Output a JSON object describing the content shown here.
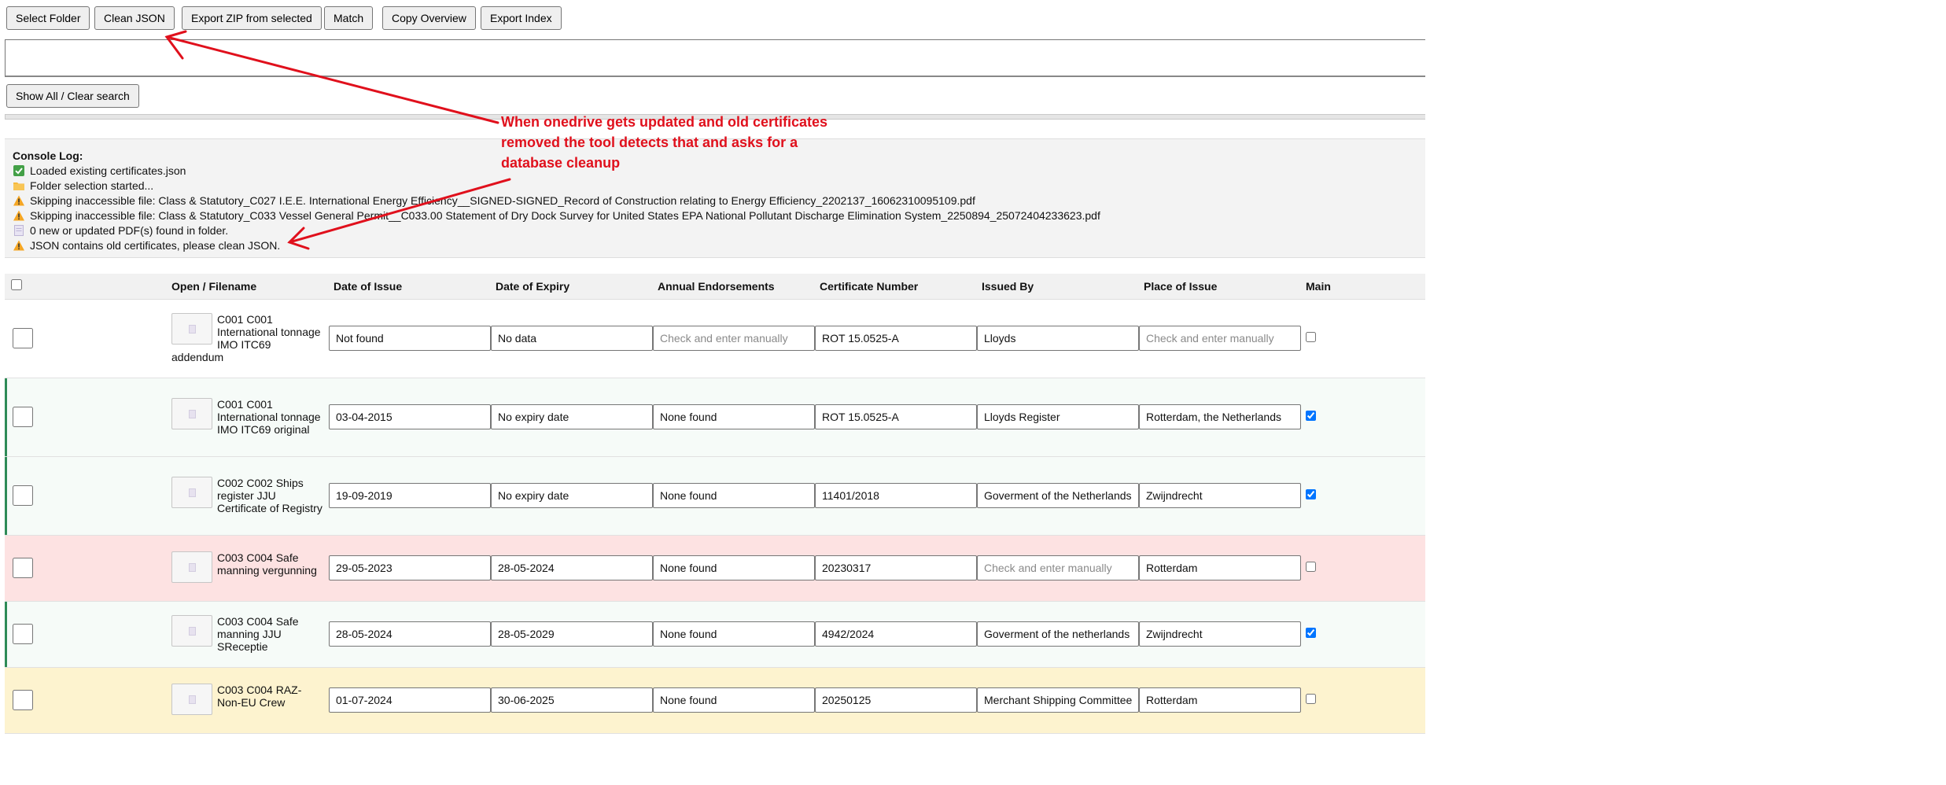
{
  "toolbar": {
    "buttons": [
      "Select Folder",
      "Clean JSON",
      "Export ZIP from selected",
      "Match",
      "Copy Overview",
      "Export Index"
    ],
    "show_all_label": "Show All / Clear search"
  },
  "console": {
    "title": "Console Log:",
    "lines": [
      {
        "icon": "check-icon",
        "text": "Loaded existing certificates.json"
      },
      {
        "icon": "folder-icon",
        "text": "Folder selection started..."
      },
      {
        "icon": "warning-icon",
        "text": "Skipping inaccessible file: Class & Statutory_C027 I.E.E. International Energy Efficiency__SIGNED-SIGNED_Record of Construction relating to Energy Efficiency_2202137_16062310095109.pdf"
      },
      {
        "icon": "warning-icon",
        "text": "Skipping inaccessible file: Class & Statutory_C033 Vessel General Permit__C033.00 Statement of Dry Dock Survey for United States EPA National Pollutant Discharge Elimination System_2250894_25072404233623.pdf"
      },
      {
        "icon": "page-icon",
        "text": "0 new or updated PDF(s) found in folder."
      },
      {
        "icon": "warning-icon",
        "text": "JSON contains old certificates, please clean JSON."
      }
    ]
  },
  "annotation": {
    "text": "When onedrive gets updated and old certificates removed the tool detects that and asks for a database cleanup",
    "color": "#e0101c"
  },
  "table": {
    "headers": [
      "Open / Filename",
      "Date of Issue",
      "Date of Expiry",
      "Annual Endorsements",
      "Certificate Number",
      "Issued By",
      "Place of Issue",
      "Main"
    ],
    "placeholder": "Check and enter manually",
    "status_colors": {
      "expired": "#fde2e2",
      "expiring": "#fdf3cf",
      "main": "#f6fbf8",
      "main_marker": "#2e8b57"
    },
    "rows": [
      {
        "filename": "C001 C001 International tonnage IMO ITC69 addendum",
        "date_of_issue": "Not found",
        "date_of_expiry": "No data",
        "annual_endorsements": "",
        "certificate_number": "ROT 15.0525-A",
        "issued_by": "Lloyds",
        "place_of_issue": "",
        "main": false,
        "status": "normal"
      },
      {
        "filename": "C001 C001 International tonnage IMO ITC69 original",
        "date_of_issue": "03-04-2015",
        "date_of_expiry": "No expiry date",
        "annual_endorsements": "None found",
        "certificate_number": "ROT 15.0525-A",
        "issued_by": "Lloyds Register",
        "place_of_issue": "Rotterdam, the Netherlands",
        "main": true,
        "status": "main"
      },
      {
        "filename": "C002 C002 Ships register JJU Certificate of Registry",
        "date_of_issue": "19-09-2019",
        "date_of_expiry": "No expiry date",
        "annual_endorsements": "None found",
        "certificate_number": "11401/2018",
        "issued_by": "Goverment of the Netherlands",
        "place_of_issue": "Zwijndrecht",
        "main": true,
        "status": "main"
      },
      {
        "filename": "C003 C004 Safe manning vergunning",
        "date_of_issue": "29-05-2023",
        "date_of_expiry": "28-05-2024",
        "annual_endorsements": "None found",
        "certificate_number": "20230317",
        "issued_by": "",
        "place_of_issue": "Rotterdam",
        "main": false,
        "status": "expired"
      },
      {
        "filename": "C003 C004 Safe manning JJU SReceptie",
        "date_of_issue": "28-05-2024",
        "date_of_expiry": "28-05-2029",
        "annual_endorsements": "None found",
        "certificate_number": "4942/2024",
        "issued_by": "Goverment of the netherlands",
        "place_of_issue": "Zwijndrecht",
        "main": true,
        "status": "main"
      },
      {
        "filename": "C003 C004 RAZ-Non-EU Crew",
        "date_of_issue": "01-07-2024",
        "date_of_expiry": "30-06-2025",
        "annual_endorsements": "None found",
        "certificate_number": "20250125",
        "issued_by": "Merchant Shipping Committee",
        "place_of_issue": "Rotterdam",
        "main": false,
        "status": "expiring"
      }
    ]
  }
}
